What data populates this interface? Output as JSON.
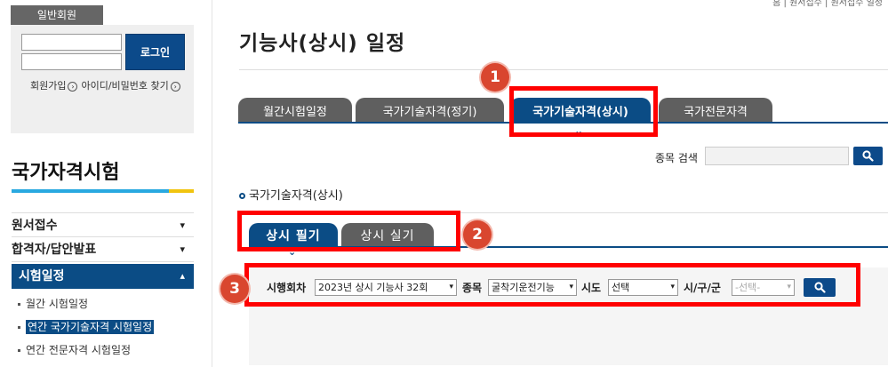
{
  "sidebar": {
    "member_tab": "일반회원",
    "login_button": "로그인",
    "links": [
      "회원가입",
      "아이디/비밀번호 찾기"
    ],
    "section_title": "국가자격시험",
    "menus": [
      {
        "label": "원서접수",
        "chevron": "⌄"
      },
      {
        "label": "합격자/답안발표",
        "chevron": "⌄"
      },
      {
        "label": "시험일정",
        "chevron": "⌃"
      }
    ],
    "submenu": [
      "월간 시험일정",
      "연간 국가기술자격 시험일정",
      "연간 전문자격 시험일정"
    ]
  },
  "header": {
    "breadcrumb": "홈 | 원서접수 | 원서접수 일정",
    "page_title": "기능사(상시) 일정"
  },
  "tabs": [
    "월간시험일정",
    "국가기술자격(정기)",
    "국가기술자격(상시)",
    "국가전문자격"
  ],
  "active_tab": "국가기술자격(상시)",
  "search": {
    "label": "종목 검색",
    "value": ""
  },
  "section": {
    "label": "국가기술자격(상시)"
  },
  "subtabs": [
    "상시 필기",
    "상시 실기"
  ],
  "filters": {
    "round_label": "시행회차",
    "round_value": "2023년 상시 기능사 32회",
    "item_label": "종목",
    "item_value": "굴착기운전기능",
    "region_label": "시도",
    "region_value": "선택",
    "district_label": "시/구/군",
    "district_value": "-선택-"
  },
  "annotations": [
    "1",
    "2",
    "3"
  ],
  "colors": {
    "primary": "#0b4c85",
    "tab_gray": "#5f5f5f",
    "highlight": "#ff0000",
    "badge": "#d9462f"
  }
}
